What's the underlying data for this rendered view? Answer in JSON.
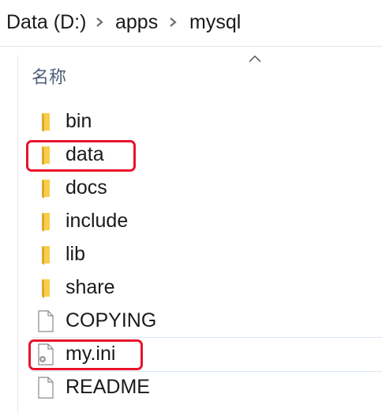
{
  "breadcrumb": {
    "items": [
      "Data (D:)",
      "apps",
      "mysql"
    ]
  },
  "list": {
    "column_header": "名称",
    "items": [
      {
        "name": "bin",
        "type": "folder"
      },
      {
        "name": "data",
        "type": "folder"
      },
      {
        "name": "docs",
        "type": "folder"
      },
      {
        "name": "include",
        "type": "folder"
      },
      {
        "name": "lib",
        "type": "folder"
      },
      {
        "name": "share",
        "type": "folder"
      },
      {
        "name": "COPYING",
        "type": "file"
      },
      {
        "name": "my.ini",
        "type": "config-file"
      },
      {
        "name": "README",
        "type": "file"
      }
    ]
  },
  "annotations": {
    "highlight_color": "#e8132b",
    "highlighted_items": [
      "data",
      "my.ini"
    ]
  },
  "colors": {
    "folder": "#f5c542",
    "header_text": "#4c607a"
  }
}
